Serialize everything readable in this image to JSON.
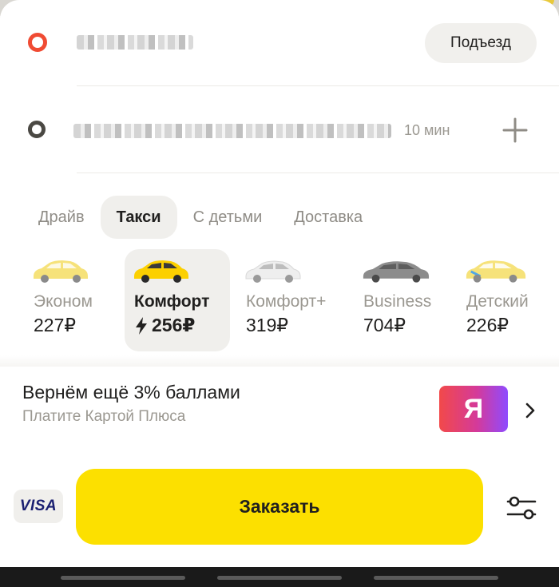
{
  "route": {
    "entrance_label": "Подъезд",
    "eta": "10 мин"
  },
  "tabs": [
    {
      "label": "Драйв"
    },
    {
      "label": "Такси"
    },
    {
      "label": "С детьми"
    },
    {
      "label": "Доставка"
    }
  ],
  "tariffs": [
    {
      "name": "Эконом",
      "price": "227₽",
      "car_color": "#f6e27a"
    },
    {
      "name": "Комфорт",
      "price": "256₽",
      "car_color": "#fcd000"
    },
    {
      "name": "Комфорт+",
      "price": "319₽",
      "car_color": "#f2f2f2"
    },
    {
      "name": "Business",
      "price": "704₽",
      "car_color": "#8c8c8c"
    },
    {
      "name": "Детский",
      "price": "226₽",
      "car_color": "#f6e27a"
    }
  ],
  "promo": {
    "title": "Вернём ещё 3% баллами",
    "subtitle": "Платите Картой Плюса",
    "logo_letter": "Я"
  },
  "payment": {
    "card_brand": "VISA"
  },
  "order": {
    "label": "Заказать"
  },
  "colors": {
    "accent": "#fce000",
    "from_dot": "#f04b33",
    "to_dot": "#4a4843"
  }
}
